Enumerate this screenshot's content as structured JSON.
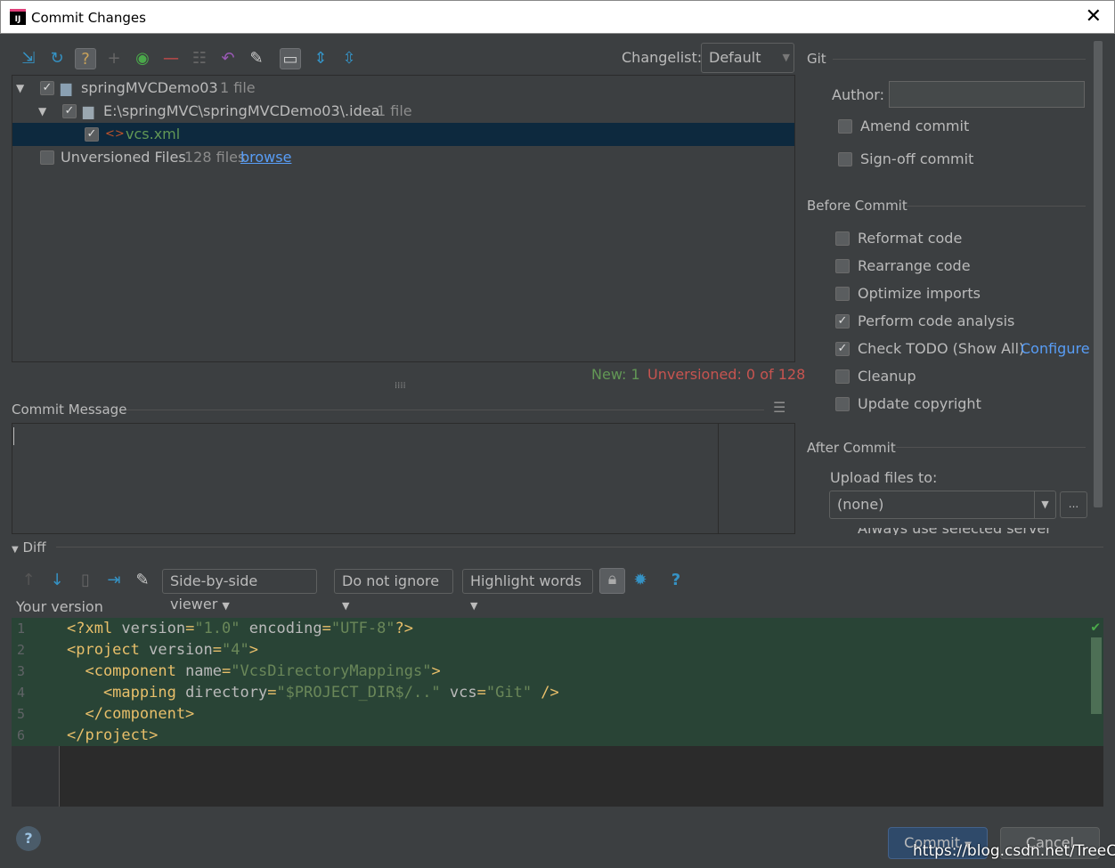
{
  "window": {
    "title": "Commit Changes",
    "logo": "IJ"
  },
  "toolbar": {
    "icons": [
      "move-to-changelist-icon",
      "refresh-icon",
      "unversioned-files-icon",
      "add-icon",
      "show-diff-icon",
      "remove-icon",
      "group-icon",
      "rollback-icon",
      "edit-source-icon",
      "group-by-directory-icon",
      "expand-all-icon",
      "collapse-all-icon"
    ],
    "changelist_label": "Changelist:",
    "changelist_value": "Default"
  },
  "tree": {
    "root": {
      "name": "springMVCDemo03",
      "count": "1 file"
    },
    "dir": {
      "name": "E:\\springMVC\\springMVCDemo03\\.idea",
      "count": "1 file"
    },
    "file": "vcs.xml",
    "unversioned": {
      "name": "Unversioned Files",
      "count": "128 files",
      "link": "browse"
    }
  },
  "status": {
    "new": "New: 1",
    "unversioned": "Unversioned: 0 of 128"
  },
  "commit_message": {
    "label": "Commit Message",
    "value": ""
  },
  "git": {
    "title": "Git",
    "author_label": "Author:",
    "author_value": "",
    "amend": "Amend commit",
    "signoff": "Sign-off commit"
  },
  "before_commit": {
    "title": "Before Commit",
    "options": [
      {
        "label": "Reformat code",
        "checked": false
      },
      {
        "label": "Rearrange code",
        "checked": false
      },
      {
        "label": "Optimize imports",
        "checked": false
      },
      {
        "label": "Perform code analysis",
        "checked": true
      },
      {
        "label": "Check TODO (Show All)",
        "checked": true,
        "link": "Configure"
      },
      {
        "label": "Cleanup",
        "checked": false
      },
      {
        "label": "Update copyright",
        "checked": false
      }
    ]
  },
  "after_commit": {
    "title": "After Commit",
    "upload_label": "Upload files to:",
    "upload_value": "(none)",
    "browse": "...",
    "partial": "Always use selected server"
  },
  "diff": {
    "title": "Diff",
    "viewer": "Side-by-side viewer",
    "ignore": "Do not ignore",
    "highlight": "Highlight words",
    "help": "?",
    "your_version": "Your version",
    "lines": [
      [
        [
          "tag",
          "<?xml "
        ],
        [
          "att",
          "version"
        ],
        [
          "tag",
          "="
        ],
        [
          "val",
          "\"1.0\""
        ],
        [
          "att",
          " encoding"
        ],
        [
          "tag",
          "="
        ],
        [
          "val",
          "\"UTF-8\""
        ],
        [
          "tag",
          "?>"
        ]
      ],
      [
        [
          "tag",
          "<project "
        ],
        [
          "att",
          "version"
        ],
        [
          "tag",
          "="
        ],
        [
          "val",
          "\"4\""
        ],
        [
          "tag",
          ">"
        ]
      ],
      [
        [
          "tag",
          "  <component "
        ],
        [
          "att",
          "name"
        ],
        [
          "tag",
          "="
        ],
        [
          "val",
          "\"VcsDirectoryMappings\""
        ],
        [
          "tag",
          ">"
        ]
      ],
      [
        [
          "tag",
          "    <mapping "
        ],
        [
          "att",
          "directory"
        ],
        [
          "tag",
          "="
        ],
        [
          "val",
          "\"$PROJECT_DIR$/..\""
        ],
        [
          "att",
          " vcs"
        ],
        [
          "tag",
          "="
        ],
        [
          "val",
          "\"Git\""
        ],
        [
          "tag",
          " />"
        ]
      ],
      [
        [
          "tag",
          "  </component>"
        ]
      ],
      [
        [
          "tag",
          "</project>"
        ]
      ]
    ]
  },
  "buttons": {
    "commit": "Commit",
    "cancel": "Cancel",
    "help": "?"
  },
  "watermark": "https://blog.csdn.net/TreeCode"
}
